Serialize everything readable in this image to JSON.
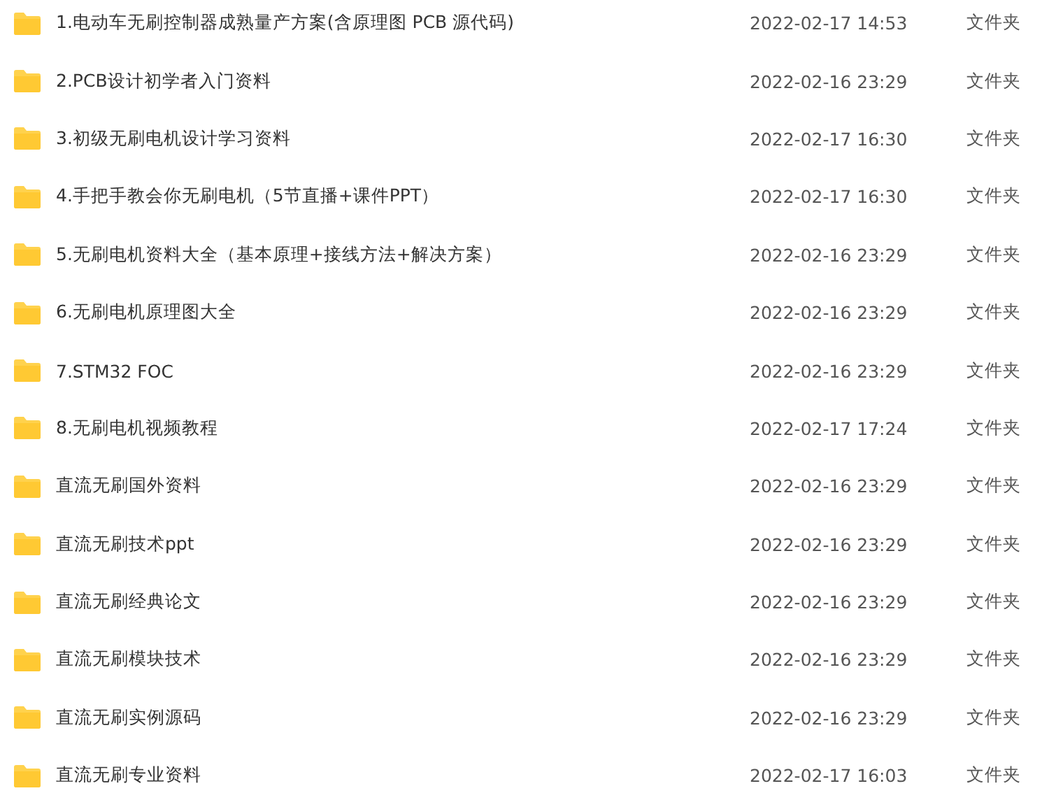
{
  "files": [
    {
      "name": "1.电动车无刷控制器成熟量产方案(含原理图 PCB 源代码)",
      "modified": "2022-02-17 14:53",
      "type": "文件夹"
    },
    {
      "name": "2.PCB设计初学者入门资料",
      "modified": "2022-02-16 23:29",
      "type": "文件夹"
    },
    {
      "name": "3.初级无刷电机设计学习资料",
      "modified": "2022-02-17 16:30",
      "type": "文件夹"
    },
    {
      "name": "4.手把手教会你无刷电机（5节直播+课件PPT）",
      "modified": "2022-02-17 16:30",
      "type": "文件夹"
    },
    {
      "name": "5.无刷电机资料大全（基本原理+接线方法+解决方案）",
      "modified": "2022-02-16 23:29",
      "type": "文件夹"
    },
    {
      "name": "6.无刷电机原理图大全",
      "modified": "2022-02-16 23:29",
      "type": "文件夹"
    },
    {
      "name": "7.STM32 FOC",
      "modified": "2022-02-16 23:29",
      "type": "文件夹"
    },
    {
      "name": "8.无刷电机视频教程",
      "modified": "2022-02-17 17:24",
      "type": "文件夹"
    },
    {
      "name": "直流无刷国外资料",
      "modified": "2022-02-16 23:29",
      "type": "文件夹"
    },
    {
      "name": "直流无刷技术ppt",
      "modified": "2022-02-16 23:29",
      "type": "文件夹"
    },
    {
      "name": "直流无刷经典论文",
      "modified": "2022-02-16 23:29",
      "type": "文件夹"
    },
    {
      "name": "直流无刷模块技术",
      "modified": "2022-02-16 23:29",
      "type": "文件夹"
    },
    {
      "name": "直流无刷实例源码",
      "modified": "2022-02-16 23:29",
      "type": "文件夹"
    },
    {
      "name": "直流无刷专业资料",
      "modified": "2022-02-17 16:03",
      "type": "文件夹"
    }
  ]
}
